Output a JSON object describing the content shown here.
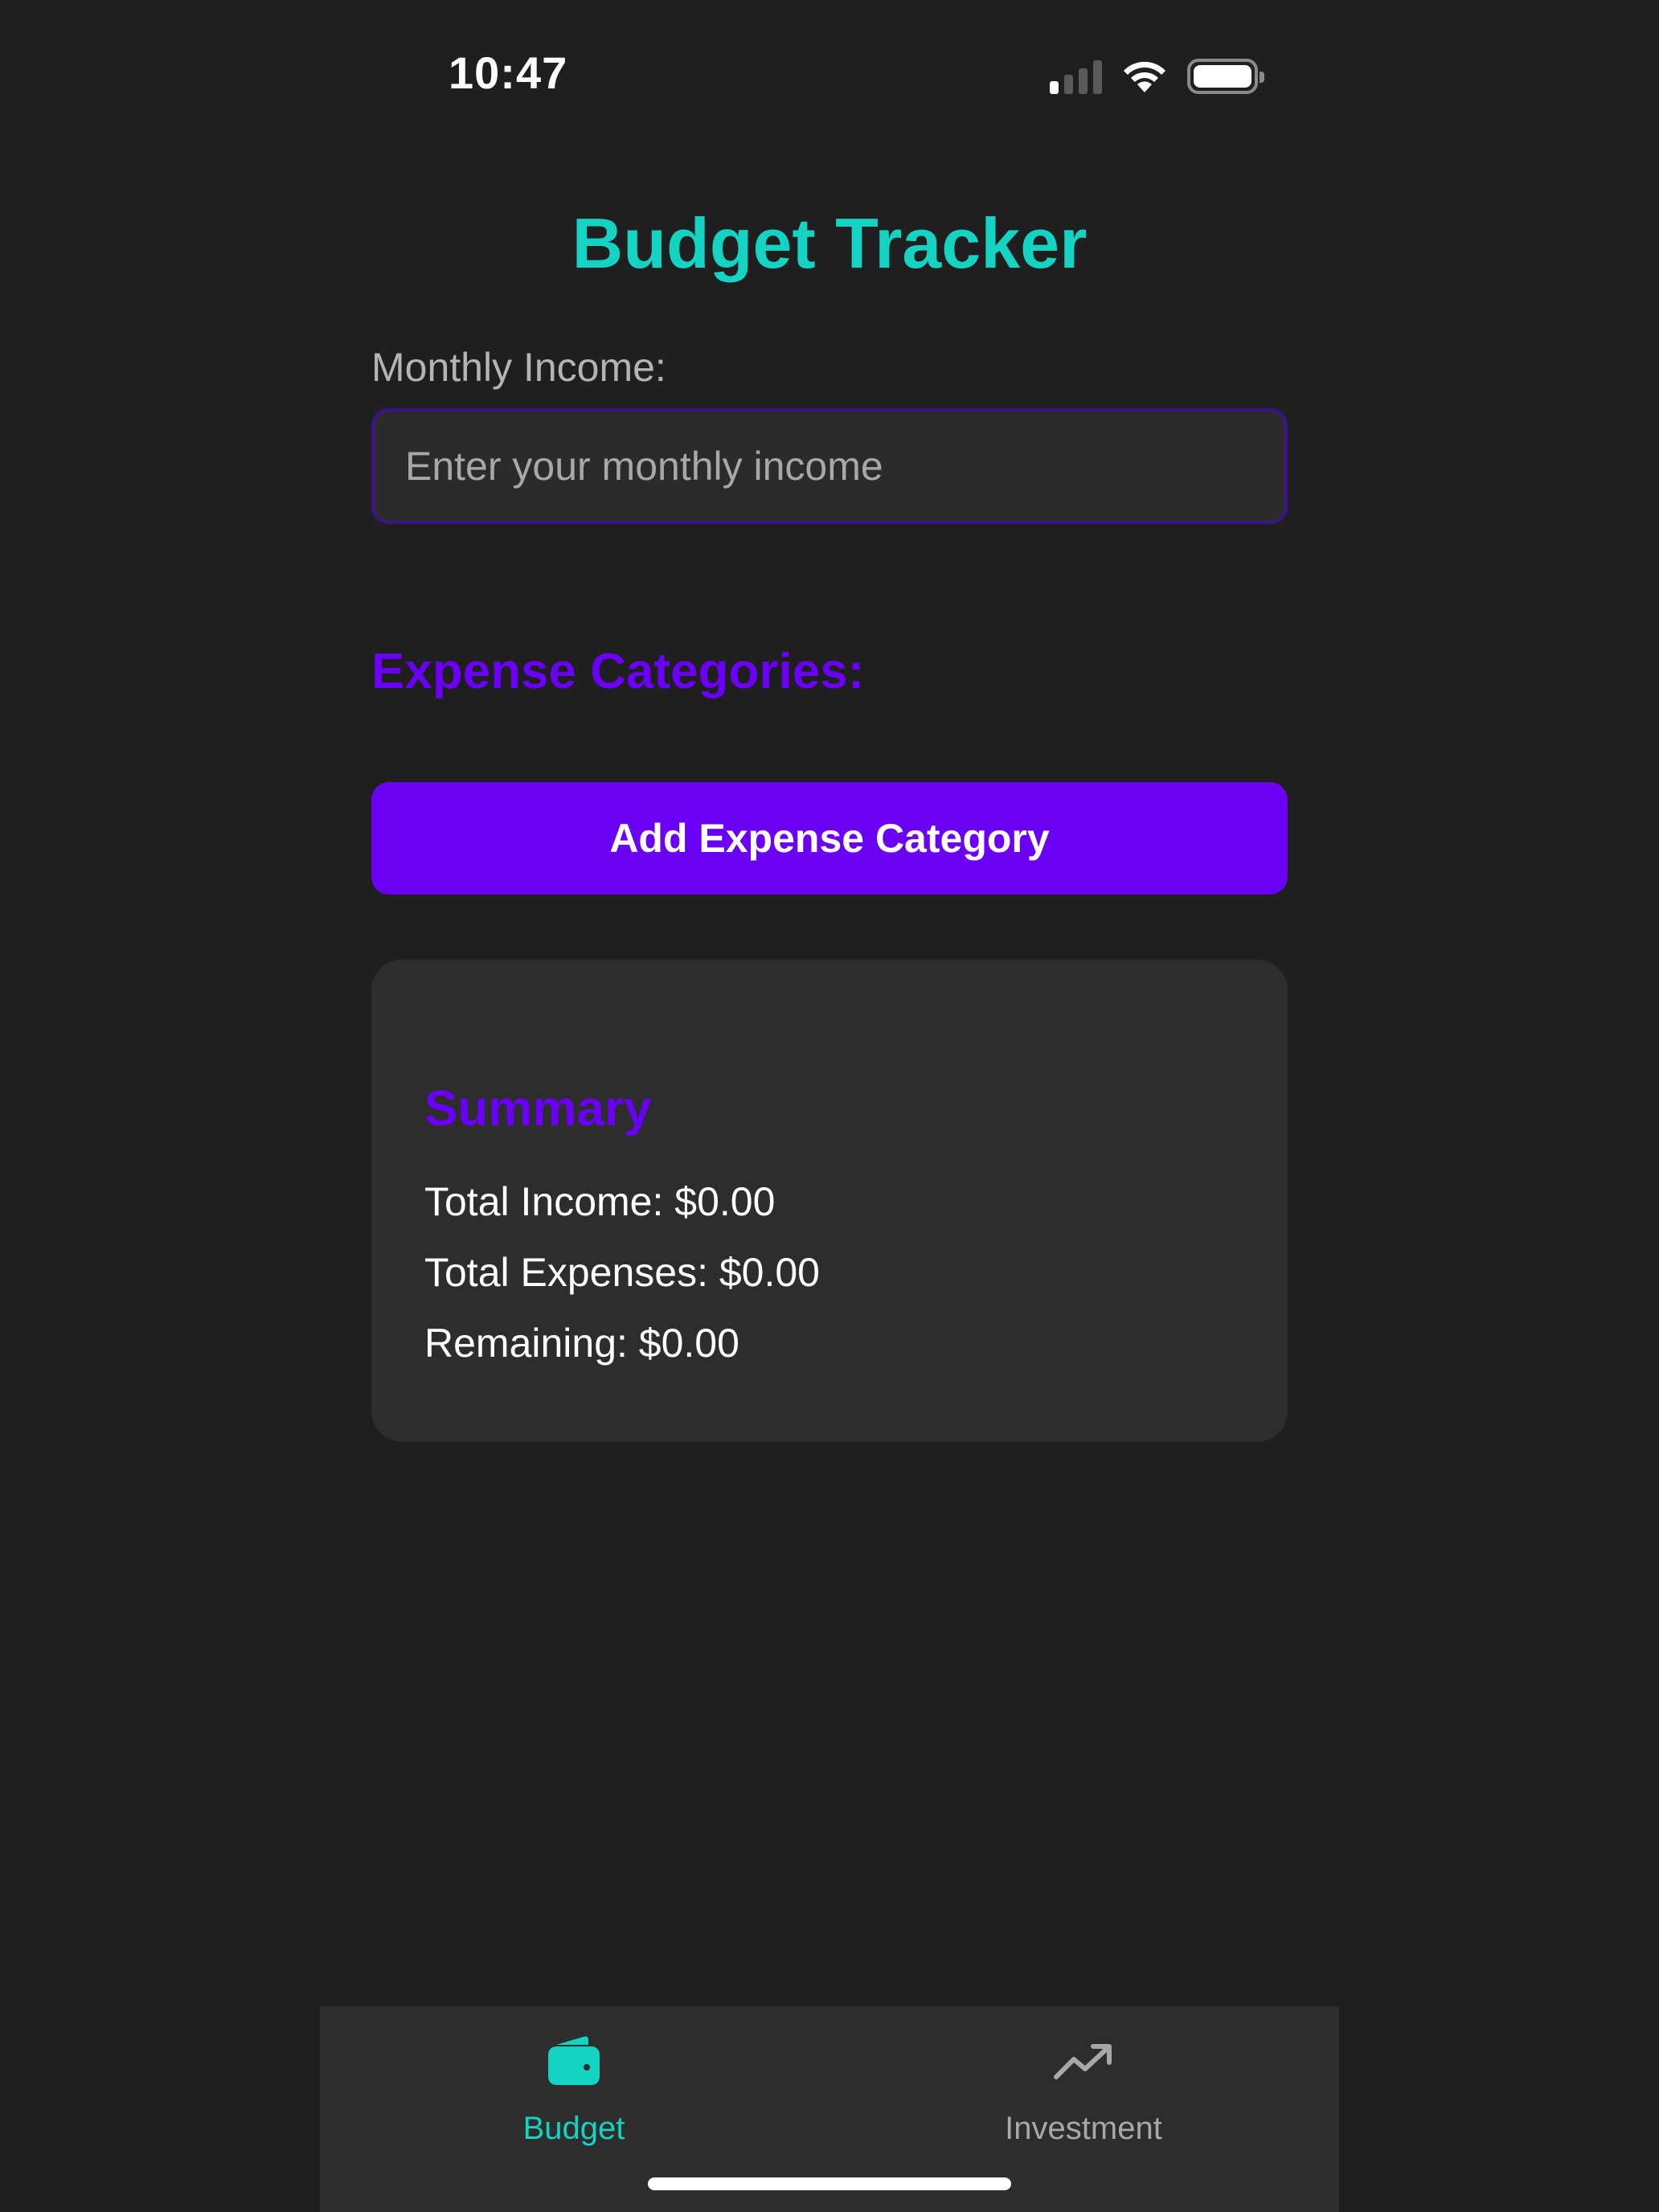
{
  "status_bar": {
    "time": "10:47",
    "signal_bars_active": 1,
    "signal_bars_total": 4
  },
  "header": {
    "title": "Budget Tracker"
  },
  "income": {
    "label": "Monthly Income:",
    "placeholder": "Enter your monthly income",
    "value": ""
  },
  "expenses": {
    "heading": "Expense Categories:",
    "add_button_label": "Add Expense Category"
  },
  "summary": {
    "title": "Summary",
    "total_income": "Total Income: $0.00",
    "total_expenses": "Total Expenses: $0.00",
    "remaining": "Remaining: $0.00"
  },
  "tab_bar": {
    "tabs": [
      {
        "label": "Budget",
        "icon": "wallet-icon",
        "active": true
      },
      {
        "label": "Investment",
        "icon": "trending-up-icon",
        "active": false
      }
    ]
  },
  "colors": {
    "background": "#1f1f1f",
    "accent_teal": "#14d3c2",
    "accent_purple": "#6a00f4",
    "card": "#2d2d2d"
  }
}
